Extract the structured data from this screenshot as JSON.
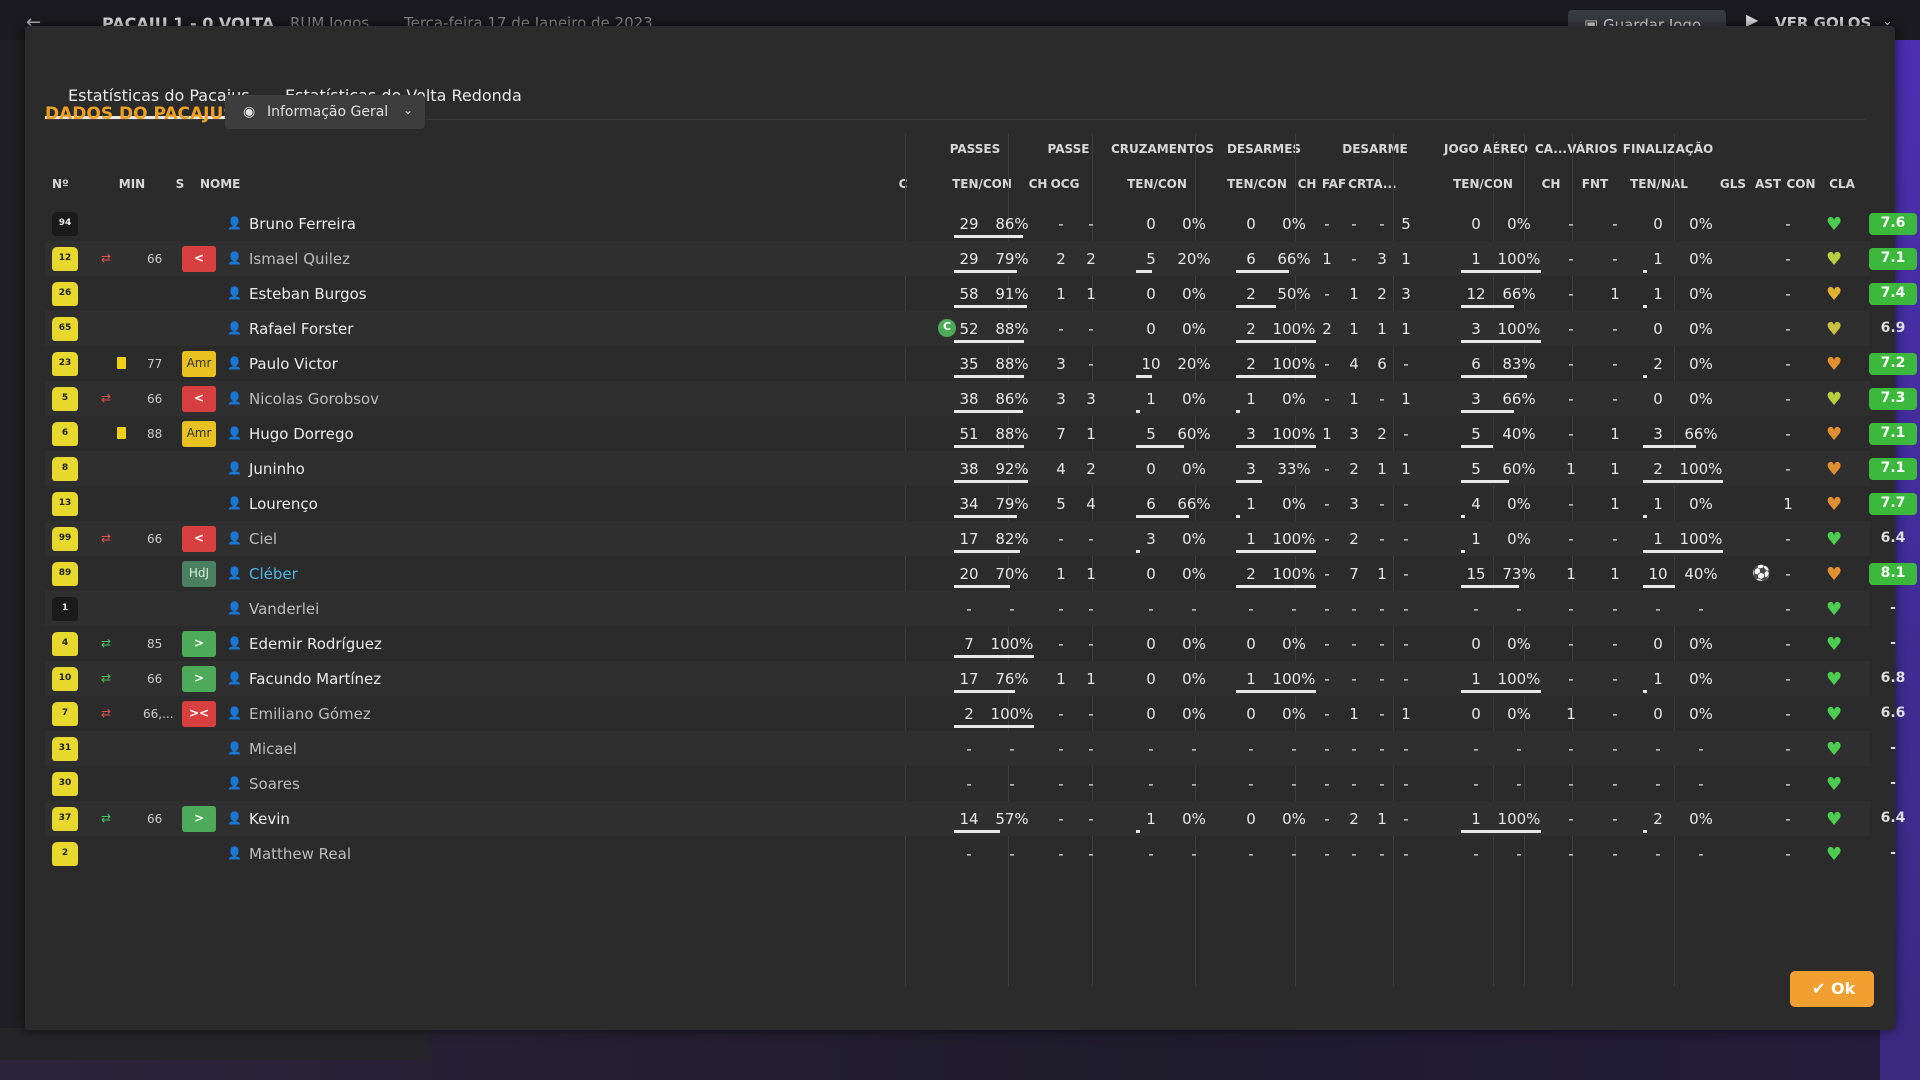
{
  "topbar": {
    "back": "←",
    "score": "PACAJU  1 - 0  VOLTA",
    "mode": "RUM Jogos",
    "date": "Terça-feira 17 de Janeiro de 2023",
    "save_label": "Guardar Jogo",
    "goals_label": "VER GOLOS"
  },
  "tabs": [
    "Estatísticas do Pacajus",
    "Estatísticas do Volta Redonda"
  ],
  "title": "DADOS DO PACAJUS",
  "view_dropdown": "Informação Geral",
  "group_headers": [
    "PASSES",
    "PASSE",
    "CRUZAMENTOS",
    "DESARMES",
    "DESARME",
    "JOGO AÉREO",
    "CA...",
    "VÁRIOS",
    "FINALIZAÇÃO"
  ],
  "col_headers": {
    "num": "Nº",
    "min": "MIN",
    "s": "S",
    "nome": "NOME",
    "c": "C",
    "passes": "TEN/CON",
    "passe_ch": "CH",
    "passe_ocg": "OCG",
    "cruz": "TEN/CON",
    "desarmes": "TEN/CON",
    "des_ch": "CH",
    "des_faf": "FAF",
    "des_crt": "CRT",
    "des_a": "A...",
    "aereo": "TEN/CON",
    "ca_ch": "CH",
    "var_fnt": "FNT",
    "fin": "TEN/NAL",
    "gls": "GLS",
    "ast": "AST",
    "con": "CON",
    "cla": "CLA"
  },
  "players": [
    {
      "num": "94",
      "gk": true,
      "min": "",
      "sub": "",
      "card": false,
      "badge": "",
      "name": "Bruno Ferreira",
      "style": "",
      "pass": [
        "29",
        "86%"
      ],
      "pass_fill": 0.86,
      "pch": "-",
      "pocg": "-",
      "cruz": [
        "0",
        "0%"
      ],
      "cruz_fill": 0,
      "des": [
        "0",
        "0%"
      ],
      "des_fill": 0,
      "dch": "-",
      "dfaf": "-",
      "dcrt": "-",
      "da": "5",
      "aer": [
        "0",
        "0%"
      ],
      "aer_fill": 0,
      "cach": "-",
      "fnt": "-",
      "fin": [
        "0",
        "0%"
      ],
      "fin_fill": 0,
      "gls": "",
      "ast": "-",
      "heart": "#4ccc50",
      "cla": "7.6",
      "cla_green": true
    },
    {
      "num": "12",
      "gk": false,
      "min": "66",
      "sub": "out",
      "card": false,
      "badge": "red",
      "badge_text": "<",
      "name": "Ismael Quilez",
      "style": "sub",
      "pass": [
        "29",
        "79%"
      ],
      "pass_fill": 0.79,
      "pch": "2",
      "pocg": "2",
      "cruz": [
        "5",
        "20%"
      ],
      "cruz_fill": 0.2,
      "des": [
        "6",
        "66%"
      ],
      "des_fill": 0.66,
      "dch": "1",
      "dfaf": "-",
      "dcrt": "3",
      "da": "1",
      "aer": [
        "1",
        "100%"
      ],
      "aer_fill": 1,
      "cach": "-",
      "fnt": "-",
      "fin": [
        "1",
        "0%"
      ],
      "fin_fill": 0.05,
      "gls": "",
      "ast": "-",
      "heart": "#b8d040",
      "cla": "7.1",
      "cla_green": true
    },
    {
      "num": "26",
      "gk": false,
      "min": "",
      "sub": "",
      "card": false,
      "badge": "",
      "name": "Esteban Burgos",
      "style": "",
      "pass": [
        "58",
        "91%"
      ],
      "pass_fill": 0.91,
      "pch": "1",
      "pocg": "1",
      "cruz": [
        "0",
        "0%"
      ],
      "cruz_fill": 0,
      "des": [
        "2",
        "50%"
      ],
      "des_fill": 0.5,
      "dch": "-",
      "dfaf": "1",
      "dcrt": "2",
      "da": "3",
      "aer": [
        "12",
        "66%"
      ],
      "aer_fill": 0.66,
      "cach": "-",
      "fnt": "1",
      "fin": [
        "1",
        "0%"
      ],
      "fin_fill": 0.05,
      "gls": "",
      "ast": "-",
      "heart": "#e0b030",
      "cla": "7.4",
      "cla_green": true
    },
    {
      "num": "65",
      "gk": false,
      "min": "",
      "sub": "",
      "card": false,
      "badge": "",
      "name": "Rafael Forster",
      "style": "",
      "captain": true,
      "pass": [
        "52",
        "88%"
      ],
      "pass_fill": 0.88,
      "pch": "-",
      "pocg": "-",
      "cruz": [
        "0",
        "0%"
      ],
      "cruz_fill": 0,
      "des": [
        "2",
        "100%"
      ],
      "des_fill": 1,
      "dch": "2",
      "dfaf": "1",
      "dcrt": "1",
      "da": "1",
      "aer": [
        "3",
        "100%"
      ],
      "aer_fill": 1,
      "cach": "-",
      "fnt": "-",
      "fin": [
        "0",
        "0%"
      ],
      "fin_fill": 0,
      "gls": "",
      "ast": "-",
      "heart": "#c8c040",
      "cla": "6.9",
      "cla_green": false
    },
    {
      "num": "23",
      "gk": false,
      "min": "77",
      "sub": "",
      "card": true,
      "badge": "amr",
      "badge_text": "Amr",
      "name": "Paulo Victor",
      "style": "",
      "pass": [
        "35",
        "88%"
      ],
      "pass_fill": 0.88,
      "pch": "3",
      "pocg": "-",
      "cruz": [
        "10",
        "20%"
      ],
      "cruz_fill": 0.2,
      "des": [
        "2",
        "100%"
      ],
      "des_fill": 1,
      "dch": "-",
      "dfaf": "4",
      "dcrt": "6",
      "da": "-",
      "aer": [
        "6",
        "83%"
      ],
      "aer_fill": 0.83,
      "cach": "-",
      "fnt": "-",
      "fin": [
        "2",
        "0%"
      ],
      "fin_fill": 0.05,
      "gls": "",
      "ast": "-",
      "heart": "#e09030",
      "cla": "7.2",
      "cla_green": true
    },
    {
      "num": "5",
      "gk": false,
      "min": "66",
      "sub": "out",
      "card": false,
      "badge": "red",
      "badge_text": "<",
      "name": "Nicolas Gorobsov",
      "style": "sub",
      "pass": [
        "38",
        "86%"
      ],
      "pass_fill": 0.86,
      "pch": "3",
      "pocg": "3",
      "cruz": [
        "1",
        "0%"
      ],
      "cruz_fill": 0.05,
      "des": [
        "1",
        "0%"
      ],
      "des_fill": 0.05,
      "dch": "-",
      "dfaf": "1",
      "dcrt": "-",
      "da": "1",
      "aer": [
        "3",
        "66%"
      ],
      "aer_fill": 0.66,
      "cach": "-",
      "fnt": "-",
      "fin": [
        "0",
        "0%"
      ],
      "fin_fill": 0,
      "gls": "",
      "ast": "-",
      "heart": "#b8d040",
      "cla": "7.3",
      "cla_green": true
    },
    {
      "num": "6",
      "gk": false,
      "min": "88",
      "sub": "",
      "card": true,
      "badge": "amr",
      "badge_text": "Amr",
      "name": "Hugo Dorrego",
      "style": "",
      "pass": [
        "51",
        "88%"
      ],
      "pass_fill": 0.88,
      "pch": "7",
      "pocg": "1",
      "cruz": [
        "5",
        "60%"
      ],
      "cruz_fill": 0.6,
      "des": [
        "3",
        "100%"
      ],
      "des_fill": 1,
      "dch": "1",
      "dfaf": "3",
      "dcrt": "2",
      "da": "-",
      "aer": [
        "5",
        "40%"
      ],
      "aer_fill": 0.4,
      "cach": "-",
      "fnt": "1",
      "fin": [
        "3",
        "66%"
      ],
      "fin_fill": 0.66,
      "gls": "",
      "ast": "-",
      "heart": "#e09030",
      "cla": "7.1",
      "cla_green": true
    },
    {
      "num": "8",
      "gk": false,
      "min": "",
      "sub": "",
      "card": false,
      "badge": "",
      "name": "Juninho",
      "style": "",
      "pass": [
        "38",
        "92%"
      ],
      "pass_fill": 0.92,
      "pch": "4",
      "pocg": "2",
      "cruz": [
        "0",
        "0%"
      ],
      "cruz_fill": 0,
      "des": [
        "3",
        "33%"
      ],
      "des_fill": 0.33,
      "dch": "-",
      "dfaf": "2",
      "dcrt": "1",
      "da": "1",
      "aer": [
        "5",
        "60%"
      ],
      "aer_fill": 0.6,
      "cach": "1",
      "fnt": "1",
      "fin": [
        "2",
        "100%"
      ],
      "fin_fill": 1,
      "gls": "",
      "ast": "-",
      "heart": "#e09030",
      "cla": "7.1",
      "cla_green": true
    },
    {
      "num": "13",
      "gk": false,
      "min": "",
      "sub": "",
      "card": false,
      "badge": "",
      "name": "Lourenço",
      "style": "",
      "pass": [
        "34",
        "79%"
      ],
      "pass_fill": 0.79,
      "pch": "5",
      "pocg": "4",
      "cruz": [
        "6",
        "66%"
      ],
      "cruz_fill": 0.66,
      "des": [
        "1",
        "0%"
      ],
      "des_fill": 0.05,
      "dch": "-",
      "dfaf": "3",
      "dcrt": "-",
      "da": "-",
      "aer": [
        "4",
        "0%"
      ],
      "aer_fill": 0.05,
      "cach": "-",
      "fnt": "1",
      "fin": [
        "1",
        "0%"
      ],
      "fin_fill": 0.05,
      "gls": "",
      "ast": "1",
      "heart": "#e09030",
      "cla": "7.7",
      "cla_green": true
    },
    {
      "num": "99",
      "gk": false,
      "min": "66",
      "sub": "out",
      "card": false,
      "badge": "red",
      "badge_text": "<",
      "name": "Ciel",
      "style": "sub",
      "pass": [
        "17",
        "82%"
      ],
      "pass_fill": 0.82,
      "pch": "-",
      "pocg": "-",
      "cruz": [
        "3",
        "0%"
      ],
      "cruz_fill": 0.05,
      "des": [
        "1",
        "100%"
      ],
      "des_fill": 1,
      "dch": "-",
      "dfaf": "2",
      "dcrt": "-",
      "da": "-",
      "aer": [
        "1",
        "0%"
      ],
      "aer_fill": 0.05,
      "cach": "-",
      "fnt": "-",
      "fin": [
        "1",
        "100%"
      ],
      "fin_fill": 1,
      "gls": "",
      "ast": "-",
      "heart": "#4ccc50",
      "cla": "6.4",
      "cla_green": false
    },
    {
      "num": "89",
      "gk": false,
      "min": "",
      "sub": "",
      "card": false,
      "badge": "hdj",
      "badge_text": "HdJ",
      "name": "Cléber",
      "style": "hl",
      "pass": [
        "20",
        "70%"
      ],
      "pass_fill": 0.7,
      "pch": "1",
      "pocg": "1",
      "cruz": [
        "0",
        "0%"
      ],
      "cruz_fill": 0,
      "des": [
        "2",
        "100%"
      ],
      "des_fill": 1,
      "dch": "-",
      "dfaf": "7",
      "dcrt": "1",
      "da": "-",
      "aer": [
        "15",
        "73%"
      ],
      "aer_fill": 0.73,
      "cach": "1",
      "fnt": "1",
      "fin": [
        "10",
        "40%"
      ],
      "fin_fill": 0.4,
      "gls": "gear",
      "ast": "-",
      "heart": "#e09030",
      "cla": "8.1",
      "cla_green": true
    },
    {
      "num": "1",
      "gk": true,
      "min": "",
      "sub": "",
      "card": false,
      "badge": "",
      "name": "Vanderlei",
      "style": "sub",
      "pass": [
        "-",
        "-"
      ],
      "pass_fill": 0,
      "pch": "-",
      "pocg": "-",
      "cruz": [
        "-",
        "-"
      ],
      "cruz_fill": 0,
      "des": [
        "-",
        "-"
      ],
      "des_fill": 0,
      "dch": "-",
      "dfaf": "-",
      "dcrt": "-",
      "da": "-",
      "aer": [
        "-",
        "-"
      ],
      "aer_fill": 0,
      "cach": "-",
      "fnt": "-",
      "fin": [
        "-",
        "-"
      ],
      "fin_fill": 0,
      "gls": "",
      "ast": "-",
      "heart": "#4ccc50",
      "cla": "-",
      "cla_green": false
    },
    {
      "num": "4",
      "gk": false,
      "min": "85",
      "sub": "in",
      "card": false,
      "badge": "green",
      "badge_text": ">",
      "name": "Edemir Rodríguez",
      "style": "",
      "pass": [
        "7",
        "100%"
      ],
      "pass_fill": 1,
      "pch": "-",
      "pocg": "-",
      "cruz": [
        "0",
        "0%"
      ],
      "cruz_fill": 0,
      "des": [
        "0",
        "0%"
      ],
      "des_fill": 0,
      "dch": "-",
      "dfaf": "-",
      "dcrt": "-",
      "da": "-",
      "aer": [
        "0",
        "0%"
      ],
      "aer_fill": 0,
      "cach": "-",
      "fnt": "-",
      "fin": [
        "0",
        "0%"
      ],
      "fin_fill": 0,
      "gls": "",
      "ast": "-",
      "heart": "#4ccc50",
      "cla": "-",
      "cla_green": false
    },
    {
      "num": "10",
      "gk": false,
      "min": "66",
      "sub": "in",
      "card": false,
      "badge": "green",
      "badge_text": ">",
      "name": "Facundo Martínez",
      "style": "",
      "pass": [
        "17",
        "76%"
      ],
      "pass_fill": 0.76,
      "pch": "1",
      "pocg": "1",
      "cruz": [
        "0",
        "0%"
      ],
      "cruz_fill": 0,
      "des": [
        "1",
        "100%"
      ],
      "des_fill": 1,
      "dch": "-",
      "dfaf": "-",
      "dcrt": "-",
      "da": "-",
      "aer": [
        "1",
        "100%"
      ],
      "aer_fill": 1,
      "cach": "-",
      "fnt": "-",
      "fin": [
        "1",
        "0%"
      ],
      "fin_fill": 0.05,
      "gls": "",
      "ast": "-",
      "heart": "#4ccc50",
      "cla": "6.8",
      "cla_green": false
    },
    {
      "num": "7",
      "gk": false,
      "min": "66,...",
      "sub": "inout",
      "card": false,
      "badge": "red",
      "badge_text": "><",
      "name": "Emiliano Gómez",
      "style": "sub",
      "pass": [
        "2",
        "100%"
      ],
      "pass_fill": 1,
      "pch": "-",
      "pocg": "-",
      "cruz": [
        "0",
        "0%"
      ],
      "cruz_fill": 0,
      "des": [
        "0",
        "0%"
      ],
      "des_fill": 0,
      "dch": "-",
      "dfaf": "1",
      "dcrt": "-",
      "da": "1",
      "aer": [
        "0",
        "0%"
      ],
      "aer_fill": 0,
      "cach": "1",
      "fnt": "-",
      "fin": [
        "0",
        "0%"
      ],
      "fin_fill": 0,
      "gls": "",
      "ast": "-",
      "heart": "#4ccc50",
      "cla": "6.6",
      "cla_green": false
    },
    {
      "num": "31",
      "gk": false,
      "min": "",
      "sub": "",
      "card": false,
      "badge": "",
      "name": "Micael",
      "style": "sub",
      "pass": [
        "-",
        "-"
      ],
      "pass_fill": 0,
      "pch": "-",
      "pocg": "-",
      "cruz": [
        "-",
        "-"
      ],
      "cruz_fill": 0,
      "des": [
        "-",
        "-"
      ],
      "des_fill": 0,
      "dch": "-",
      "dfaf": "-",
      "dcrt": "-",
      "da": "-",
      "aer": [
        "-",
        "-"
      ],
      "aer_fill": 0,
      "cach": "-",
      "fnt": "-",
      "fin": [
        "-",
        "-"
      ],
      "fin_fill": 0,
      "gls": "",
      "ast": "-",
      "heart": "#4ccc50",
      "cla": "-",
      "cla_green": false
    },
    {
      "num": "30",
      "gk": false,
      "min": "",
      "sub": "",
      "card": false,
      "badge": "",
      "name": "Soares",
      "style": "sub",
      "pass": [
        "-",
        "-"
      ],
      "pass_fill": 0,
      "pch": "-",
      "pocg": "-",
      "cruz": [
        "-",
        "-"
      ],
      "cruz_fill": 0,
      "des": [
        "-",
        "-"
      ],
      "des_fill": 0,
      "dch": "-",
      "dfaf": "-",
      "dcrt": "-",
      "da": "-",
      "aer": [
        "-",
        "-"
      ],
      "aer_fill": 0,
      "cach": "-",
      "fnt": "-",
      "fin": [
        "-",
        "-"
      ],
      "fin_fill": 0,
      "gls": "",
      "ast": "-",
      "heart": "#4ccc50",
      "cla": "-",
      "cla_green": false
    },
    {
      "num": "37",
      "gk": false,
      "min": "66",
      "sub": "in",
      "card": false,
      "badge": "green",
      "badge_text": ">",
      "name": "Kevin",
      "style": "",
      "pass": [
        "14",
        "57%"
      ],
      "pass_fill": 0.57,
      "pch": "-",
      "pocg": "-",
      "cruz": [
        "1",
        "0%"
      ],
      "cruz_fill": 0.05,
      "des": [
        "0",
        "0%"
      ],
      "des_fill": 0,
      "dch": "-",
      "dfaf": "2",
      "dcrt": "1",
      "da": "-",
      "aer": [
        "1",
        "100%"
      ],
      "aer_fill": 1,
      "cach": "-",
      "fnt": "-",
      "fin": [
        "2",
        "0%"
      ],
      "fin_fill": 0.05,
      "gls": "",
      "ast": "-",
      "heart": "#4ccc50",
      "cla": "6.4",
      "cla_green": false
    },
    {
      "num": "2",
      "gk": false,
      "min": "",
      "sub": "",
      "card": false,
      "badge": "",
      "name": "Matthew Real",
      "style": "sub",
      "pass": [
        "-",
        "-"
      ],
      "pass_fill": 0,
      "pch": "-",
      "pocg": "-",
      "cruz": [
        "-",
        "-"
      ],
      "cruz_fill": 0,
      "des": [
        "-",
        "-"
      ],
      "des_fill": 0,
      "dch": "-",
      "dfaf": "-",
      "dcrt": "-",
      "da": "-",
      "aer": [
        "-",
        "-"
      ],
      "aer_fill": 0,
      "cach": "-",
      "fnt": "-",
      "fin": [
        "-",
        "-"
      ],
      "fin_fill": 0,
      "gls": "",
      "ast": "-",
      "heart": "#4ccc50",
      "cla": "-",
      "cla_green": false
    }
  ],
  "ok_label": "Ok"
}
